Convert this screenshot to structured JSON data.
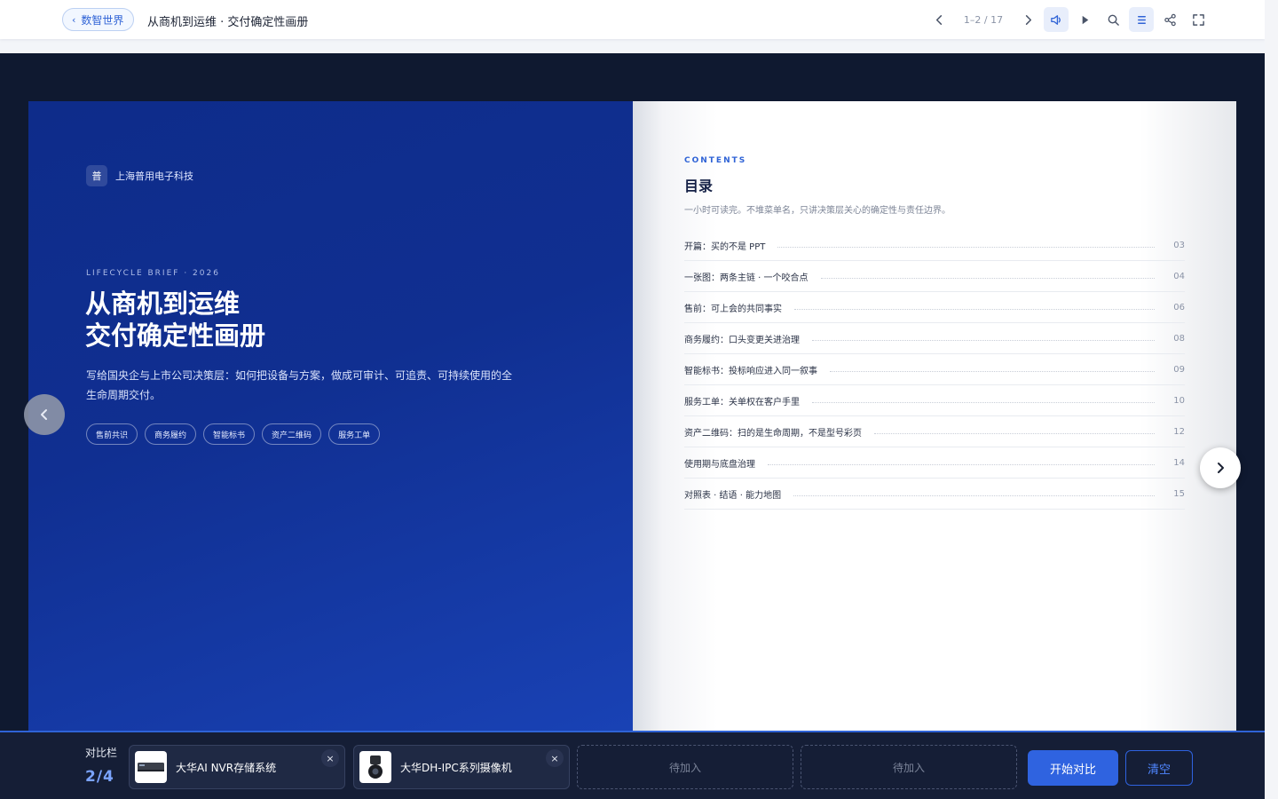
{
  "header": {
    "back_label": "数智世界",
    "doc_title": "从商机到运维 · 交付确定性画册",
    "page_indicator": "1–2 / 17",
    "icons": [
      "chevron-left-icon",
      "chevron-right-icon",
      "speaker-icon",
      "play-icon",
      "search-icon",
      "menu-icon",
      "share-icon",
      "fullscreen-icon"
    ]
  },
  "left_page": {
    "brand_mark": "普",
    "brand_name": "上海普用电子科技",
    "lifecycle": "LIFECYCLE BRIEF · 2026",
    "title_line1": "从商机到运维",
    "title_line2": "交付确定性画册",
    "description": "写给国央企与上市公司决策层：如何把设备与方案，做成可审计、可追责、可持续使用的全生命周期交付。",
    "tags": [
      "售前共识",
      "商务履约",
      "智能标书",
      "资产二维码",
      "服务工单"
    ]
  },
  "right_page": {
    "contents_label": "CONTENTS",
    "title": "目录",
    "subtitle": "一小时可读完。不堆菜单名，只讲决策层关心的确定性与责任边界。",
    "toc": [
      {
        "label": "开篇：买的不是 PPT",
        "page": "03"
      },
      {
        "label": "一张图：两条主链 · 一个咬合点",
        "page": "04"
      },
      {
        "label": "售前：可上会的共同事实",
        "page": "06"
      },
      {
        "label": "商务履约：口头变更关进治理",
        "page": "08"
      },
      {
        "label": "智能标书：投标响应进入同一叙事",
        "page": "09"
      },
      {
        "label": "服务工单：关单权在客户手里",
        "page": "10"
      },
      {
        "label": "资产二维码：扫的是生命周期，不是型号彩页",
        "page": "12"
      },
      {
        "label": "使用期与底盘治理",
        "page": "14"
      },
      {
        "label": "对照表 · 结语 · 能力地图",
        "page": "15"
      }
    ]
  },
  "compare_bar": {
    "label": "对比栏",
    "count": "2/4",
    "items": [
      {
        "name": "大华AI NVR存储系统",
        "remove": "×"
      },
      {
        "name": "大华DH-IPC系列摄像机",
        "remove": "×"
      }
    ],
    "empty_slots": [
      "待加入",
      "待加入"
    ],
    "start_label": "开始对比",
    "clear_label": "清空"
  },
  "colors": {
    "accent": "#2f63e0",
    "cover_blue": "#102f91",
    "stage_bg": "#0f1930"
  }
}
